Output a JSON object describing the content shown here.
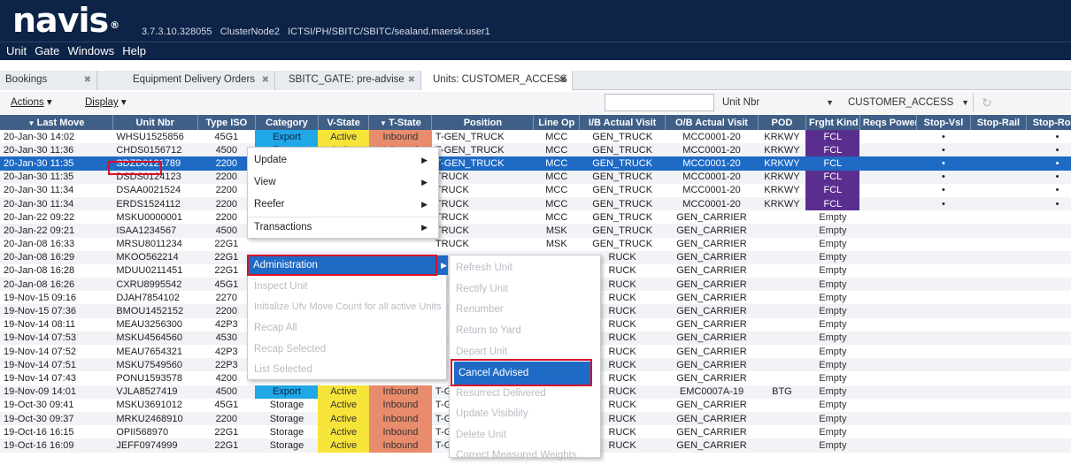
{
  "app": {
    "logo": "navis",
    "logo_mark": "®",
    "version_line": "3.7.3.10.328055   ClusterNode2   ICTSI/PH/SBITC/SBITC/sealand.maersk.user1"
  },
  "menubar": [
    "Unit",
    "Gate",
    "Windows",
    "Help"
  ],
  "tabs": [
    {
      "label": "Bookings",
      "close": "✖"
    },
    {
      "label": "Equipment Delivery Orders",
      "close": "✖"
    },
    {
      "label": "SBITC_GATE: pre-advise",
      "close": "✖"
    },
    {
      "label": "Units: CUSTOMER_ACCESS",
      "close": "✖"
    }
  ],
  "toolbar": {
    "actions": "Actions",
    "display": "Display",
    "search_value": "",
    "field_select": "Unit Nbr",
    "view_select": "CUSTOMER_ACCESS (SBITC..."
  },
  "columns": [
    "Last Move",
    "Unit Nbr",
    "Type ISO",
    "Category",
    "V-State",
    "T-State",
    "Position",
    "Line Op",
    "I/B Actual Visit",
    "O/B Actual Visit",
    "POD",
    "Frght Kind",
    "Reqs Power",
    "Stop-Vsl",
    "Stop-Rail",
    "Stop-Road"
  ],
  "rows": [
    {
      "last_move": "20-Jan-30 14:02",
      "unit": "WHSU1525856",
      "iso": "45G1",
      "cat": "Export",
      "vstate": "Active",
      "tstate": "Inbound",
      "pos": "T-GEN_TRUCK",
      "line": "MCC",
      "ib": "GEN_TRUCK",
      "ob": "MCC0001-20",
      "pod": "KRKWY",
      "fk": "FCL",
      "sv": "•",
      "sr": "",
      "sd": "•"
    },
    {
      "last_move": "20-Jan-30 11:36",
      "unit": "CHDS0156712",
      "iso": "4500",
      "cat": "Export",
      "vstate": "Active",
      "tstate": "Inbound",
      "pos": "T-GEN_TRUCK",
      "line": "MCC",
      "ib": "GEN_TRUCK",
      "ob": "MCC0001-20",
      "pod": "KRKWY",
      "fk": "FCL",
      "sv": "•",
      "sr": "",
      "sd": "•"
    },
    {
      "last_move": "20-Jan-30 11:35",
      "unit": "SDZD0121789",
      "iso": "2200",
      "cat": "Export",
      "vstate": "Active",
      "tstate": "Inbound",
      "pos": "T-GEN_TRUCK",
      "line": "MCC",
      "ib": "GEN_TRUCK",
      "ob": "MCC0001-20",
      "pod": "KRKWY",
      "fk": "FCL",
      "sv": "•",
      "sr": "",
      "sd": "•"
    },
    {
      "last_move": "20-Jan-30 11:35",
      "unit": "DSDS0124123",
      "iso": "2200",
      "cat": "",
      "vstate": "",
      "tstate": "",
      "pos": "TRUCK",
      "line": "MCC",
      "ib": "GEN_TRUCK",
      "ob": "MCC0001-20",
      "pod": "KRKWY",
      "fk": "FCL",
      "sv": "•",
      "sr": "",
      "sd": "•"
    },
    {
      "last_move": "20-Jan-30 11:34",
      "unit": "DSAA0021524",
      "iso": "2200",
      "cat": "",
      "vstate": "",
      "tstate": "",
      "pos": "TRUCK",
      "line": "MCC",
      "ib": "GEN_TRUCK",
      "ob": "MCC0001-20",
      "pod": "KRKWY",
      "fk": "FCL",
      "sv": "•",
      "sr": "",
      "sd": "•"
    },
    {
      "last_move": "20-Jan-30 11:34",
      "unit": "ERDS1524112",
      "iso": "2200",
      "cat": "",
      "vstate": "",
      "tstate": "",
      "pos": "TRUCK",
      "line": "MCC",
      "ib": "GEN_TRUCK",
      "ob": "MCC0001-20",
      "pod": "KRKWY",
      "fk": "FCL",
      "sv": "•",
      "sr": "",
      "sd": "•"
    },
    {
      "last_move": "20-Jan-22 09:22",
      "unit": "MSKU0000001",
      "iso": "2200",
      "cat": "",
      "vstate": "",
      "tstate": "",
      "pos": "TRUCK",
      "line": "MCC",
      "ib": "GEN_TRUCK",
      "ob": "GEN_CARRIER",
      "pod": "",
      "fk": "Empty",
      "sv": "",
      "sr": "",
      "sd": ""
    },
    {
      "last_move": "20-Jan-22 09:21",
      "unit": "ISAA1234567",
      "iso": "4500",
      "cat": "",
      "vstate": "",
      "tstate": "",
      "pos": "TRUCK",
      "line": "MSK",
      "ib": "GEN_TRUCK",
      "ob": "GEN_CARRIER",
      "pod": "",
      "fk": "Empty",
      "sv": "",
      "sr": "",
      "sd": ""
    },
    {
      "last_move": "20-Jan-08 16:33",
      "unit": "MRSU8011234",
      "iso": "22G1",
      "cat": "",
      "vstate": "",
      "tstate": "",
      "pos": "TRUCK",
      "line": "MSK",
      "ib": "GEN_TRUCK",
      "ob": "GEN_CARRIER",
      "pod": "",
      "fk": "Empty",
      "sv": "",
      "sr": "",
      "sd": ""
    },
    {
      "last_move": "20-Jan-08 16:29",
      "unit": "MKOO562214",
      "iso": "22G1",
      "cat": "",
      "vstate": "",
      "tstate": "",
      "pos": "",
      "line": "",
      "ib": "RUCK",
      "ob": "GEN_CARRIER",
      "pod": "",
      "fk": "Empty",
      "sv": "",
      "sr": "",
      "sd": ""
    },
    {
      "last_move": "20-Jan-08 16:28",
      "unit": "MDUU0211451",
      "iso": "22G1",
      "cat": "",
      "vstate": "",
      "tstate": "",
      "pos": "",
      "line": "",
      "ib": "RUCK",
      "ob": "GEN_CARRIER",
      "pod": "",
      "fk": "Empty",
      "sv": "",
      "sr": "",
      "sd": ""
    },
    {
      "last_move": "20-Jan-08 16:26",
      "unit": "CXRU8995542",
      "iso": "45G1",
      "cat": "",
      "vstate": "",
      "tstate": "",
      "pos": "",
      "line": "",
      "ib": "RUCK",
      "ob": "GEN_CARRIER",
      "pod": "",
      "fk": "Empty",
      "sv": "",
      "sr": "",
      "sd": ""
    },
    {
      "last_move": "19-Nov-15 09:16",
      "unit": "DJAH7854102",
      "iso": "2270",
      "cat": "",
      "vstate": "",
      "tstate": "",
      "pos": "",
      "line": "",
      "ib": "RUCK",
      "ob": "GEN_CARRIER",
      "pod": "",
      "fk": "Empty",
      "sv": "",
      "sr": "",
      "sd": ""
    },
    {
      "last_move": "19-Nov-15 07:36",
      "unit": "BMOU1452152",
      "iso": "2200",
      "cat": "",
      "vstate": "",
      "tstate": "",
      "pos": "",
      "line": "",
      "ib": "RUCK",
      "ob": "GEN_CARRIER",
      "pod": "",
      "fk": "Empty",
      "sv": "",
      "sr": "",
      "sd": ""
    },
    {
      "last_move": "19-Nov-14 08:11",
      "unit": "MEAU3256300",
      "iso": "42P3",
      "cat": "",
      "vstate": "",
      "tstate": "",
      "pos": "",
      "line": "",
      "ib": "RUCK",
      "ob": "GEN_CARRIER",
      "pod": "",
      "fk": "Empty",
      "sv": "",
      "sr": "",
      "sd": ""
    },
    {
      "last_move": "19-Nov-14 07:53",
      "unit": "MSKU4564560",
      "iso": "4530",
      "cat": "",
      "vstate": "",
      "tstate": "",
      "pos": "",
      "line": "",
      "ib": "RUCK",
      "ob": "GEN_CARRIER",
      "pod": "",
      "fk": "Empty",
      "sv": "",
      "sr": "",
      "sd": ""
    },
    {
      "last_move": "19-Nov-14 07:52",
      "unit": "MEAU7654321",
      "iso": "42P3",
      "cat": "",
      "vstate": "",
      "tstate": "",
      "pos": "",
      "line": "",
      "ib": "RUCK",
      "ob": "GEN_CARRIER",
      "pod": "",
      "fk": "Empty",
      "sv": "",
      "sr": "",
      "sd": ""
    },
    {
      "last_move": "19-Nov-14 07:51",
      "unit": "MSKU7549560",
      "iso": "22P3",
      "cat": "",
      "vstate": "",
      "tstate": "",
      "pos": "",
      "line": "",
      "ib": "RUCK",
      "ob": "GEN_CARRIER",
      "pod": "",
      "fk": "Empty",
      "sv": "",
      "sr": "",
      "sd": ""
    },
    {
      "last_move": "19-Nov-14 07:43",
      "unit": "PONU1593578",
      "iso": "4200",
      "cat": "",
      "vstate": "",
      "tstate": "",
      "pos": "",
      "line": "",
      "ib": "RUCK",
      "ob": "GEN_CARRIER",
      "pod": "",
      "fk": "Empty",
      "sv": "",
      "sr": "",
      "sd": ""
    },
    {
      "last_move": "19-Nov-09 14:01",
      "unit": "VJLA8527419",
      "iso": "4500",
      "cat": "Export",
      "vstate": "Active",
      "tstate": "Inbound",
      "pos": "T-GEN",
      "line": "",
      "ib": "RUCK",
      "ob": "EMC0007A-19",
      "pod": "BTG",
      "fk": "Empty",
      "sv": "",
      "sr": "",
      "sd": ""
    },
    {
      "last_move": "19-Oct-30 09:41",
      "unit": "MSKU3691012",
      "iso": "45G1",
      "cat": "Storage",
      "vstate": "Active",
      "tstate": "Inbound",
      "pos": "T-GEN",
      "line": "",
      "ib": "RUCK",
      "ob": "GEN_CARRIER",
      "pod": "",
      "fk": "Empty",
      "sv": "",
      "sr": "",
      "sd": ""
    },
    {
      "last_move": "19-Oct-30 09:37",
      "unit": "MRKU2468910",
      "iso": "2200",
      "cat": "Storage",
      "vstate": "Active",
      "tstate": "Inbound",
      "pos": "T-GEN",
      "line": "",
      "ib": "RUCK",
      "ob": "GEN_CARRIER",
      "pod": "",
      "fk": "Empty",
      "sv": "",
      "sr": "",
      "sd": ""
    },
    {
      "last_move": "19-Oct-16 16:15",
      "unit": "OPII568970",
      "iso": "22G1",
      "cat": "Storage",
      "vstate": "Active",
      "tstate": "Inbound",
      "pos": "T-GEN",
      "line": "",
      "ib": "RUCK",
      "ob": "GEN_CARRIER",
      "pod": "",
      "fk": "Empty",
      "sv": "",
      "sr": "",
      "sd": ""
    },
    {
      "last_move": "19-Oct-16 16:09",
      "unit": "JEFF0974999",
      "iso": "22G1",
      "cat": "Storage",
      "vstate": "Active",
      "tstate": "Inbound",
      "pos": "T-GEN",
      "line": "",
      "ib": "RUCK",
      "ob": "GEN_CARRIER",
      "pod": "",
      "fk": "Empty",
      "sv": "",
      "sr": "",
      "sd": ""
    }
  ],
  "selected_row": 2,
  "context_menu": {
    "primary": [
      {
        "label": "Update",
        "submenu": true
      },
      {
        "label": "View",
        "submenu": true
      },
      {
        "label": "Reefer",
        "submenu": true
      },
      {
        "label": "Transactions",
        "submenu": true
      }
    ],
    "administration": "Administration",
    "secondary": [
      {
        "label": "Inspect Unit",
        "disabled": true
      },
      {
        "label": "Initialize Ufv Move Count for all active Units",
        "disabled": true
      },
      {
        "label": "Recap All",
        "disabled": true
      },
      {
        "label": "Recap Selected",
        "disabled": true
      },
      {
        "label": "List Selected",
        "disabled": true
      }
    ],
    "admin_submenu": [
      {
        "label": "Refresh Unit",
        "disabled": true
      },
      {
        "label": "Rectify Unit",
        "disabled": true
      },
      {
        "label": "Renumber",
        "disabled": true
      },
      {
        "label": "Return to Yard",
        "disabled": true
      },
      {
        "label": "Depart Unit",
        "disabled": true
      },
      {
        "label": "Cancel Advised",
        "disabled": false
      },
      {
        "label": "Resurrect Delivered",
        "disabled": true
      },
      {
        "label": "Update Visibility",
        "disabled": true
      },
      {
        "label": "Delete Unit",
        "disabled": true
      },
      {
        "label": "Correct Measured Weights",
        "disabled": true
      }
    ]
  },
  "colors": {
    "header": "#0d2347",
    "grid_header": "#3f5f87",
    "selection": "#1e6ac4",
    "export": "#1fa7e6",
    "active": "#f7e43a",
    "inbound": "#e98b6d",
    "fcl": "#5a2e8f",
    "highlight_box": "#d8102a"
  }
}
